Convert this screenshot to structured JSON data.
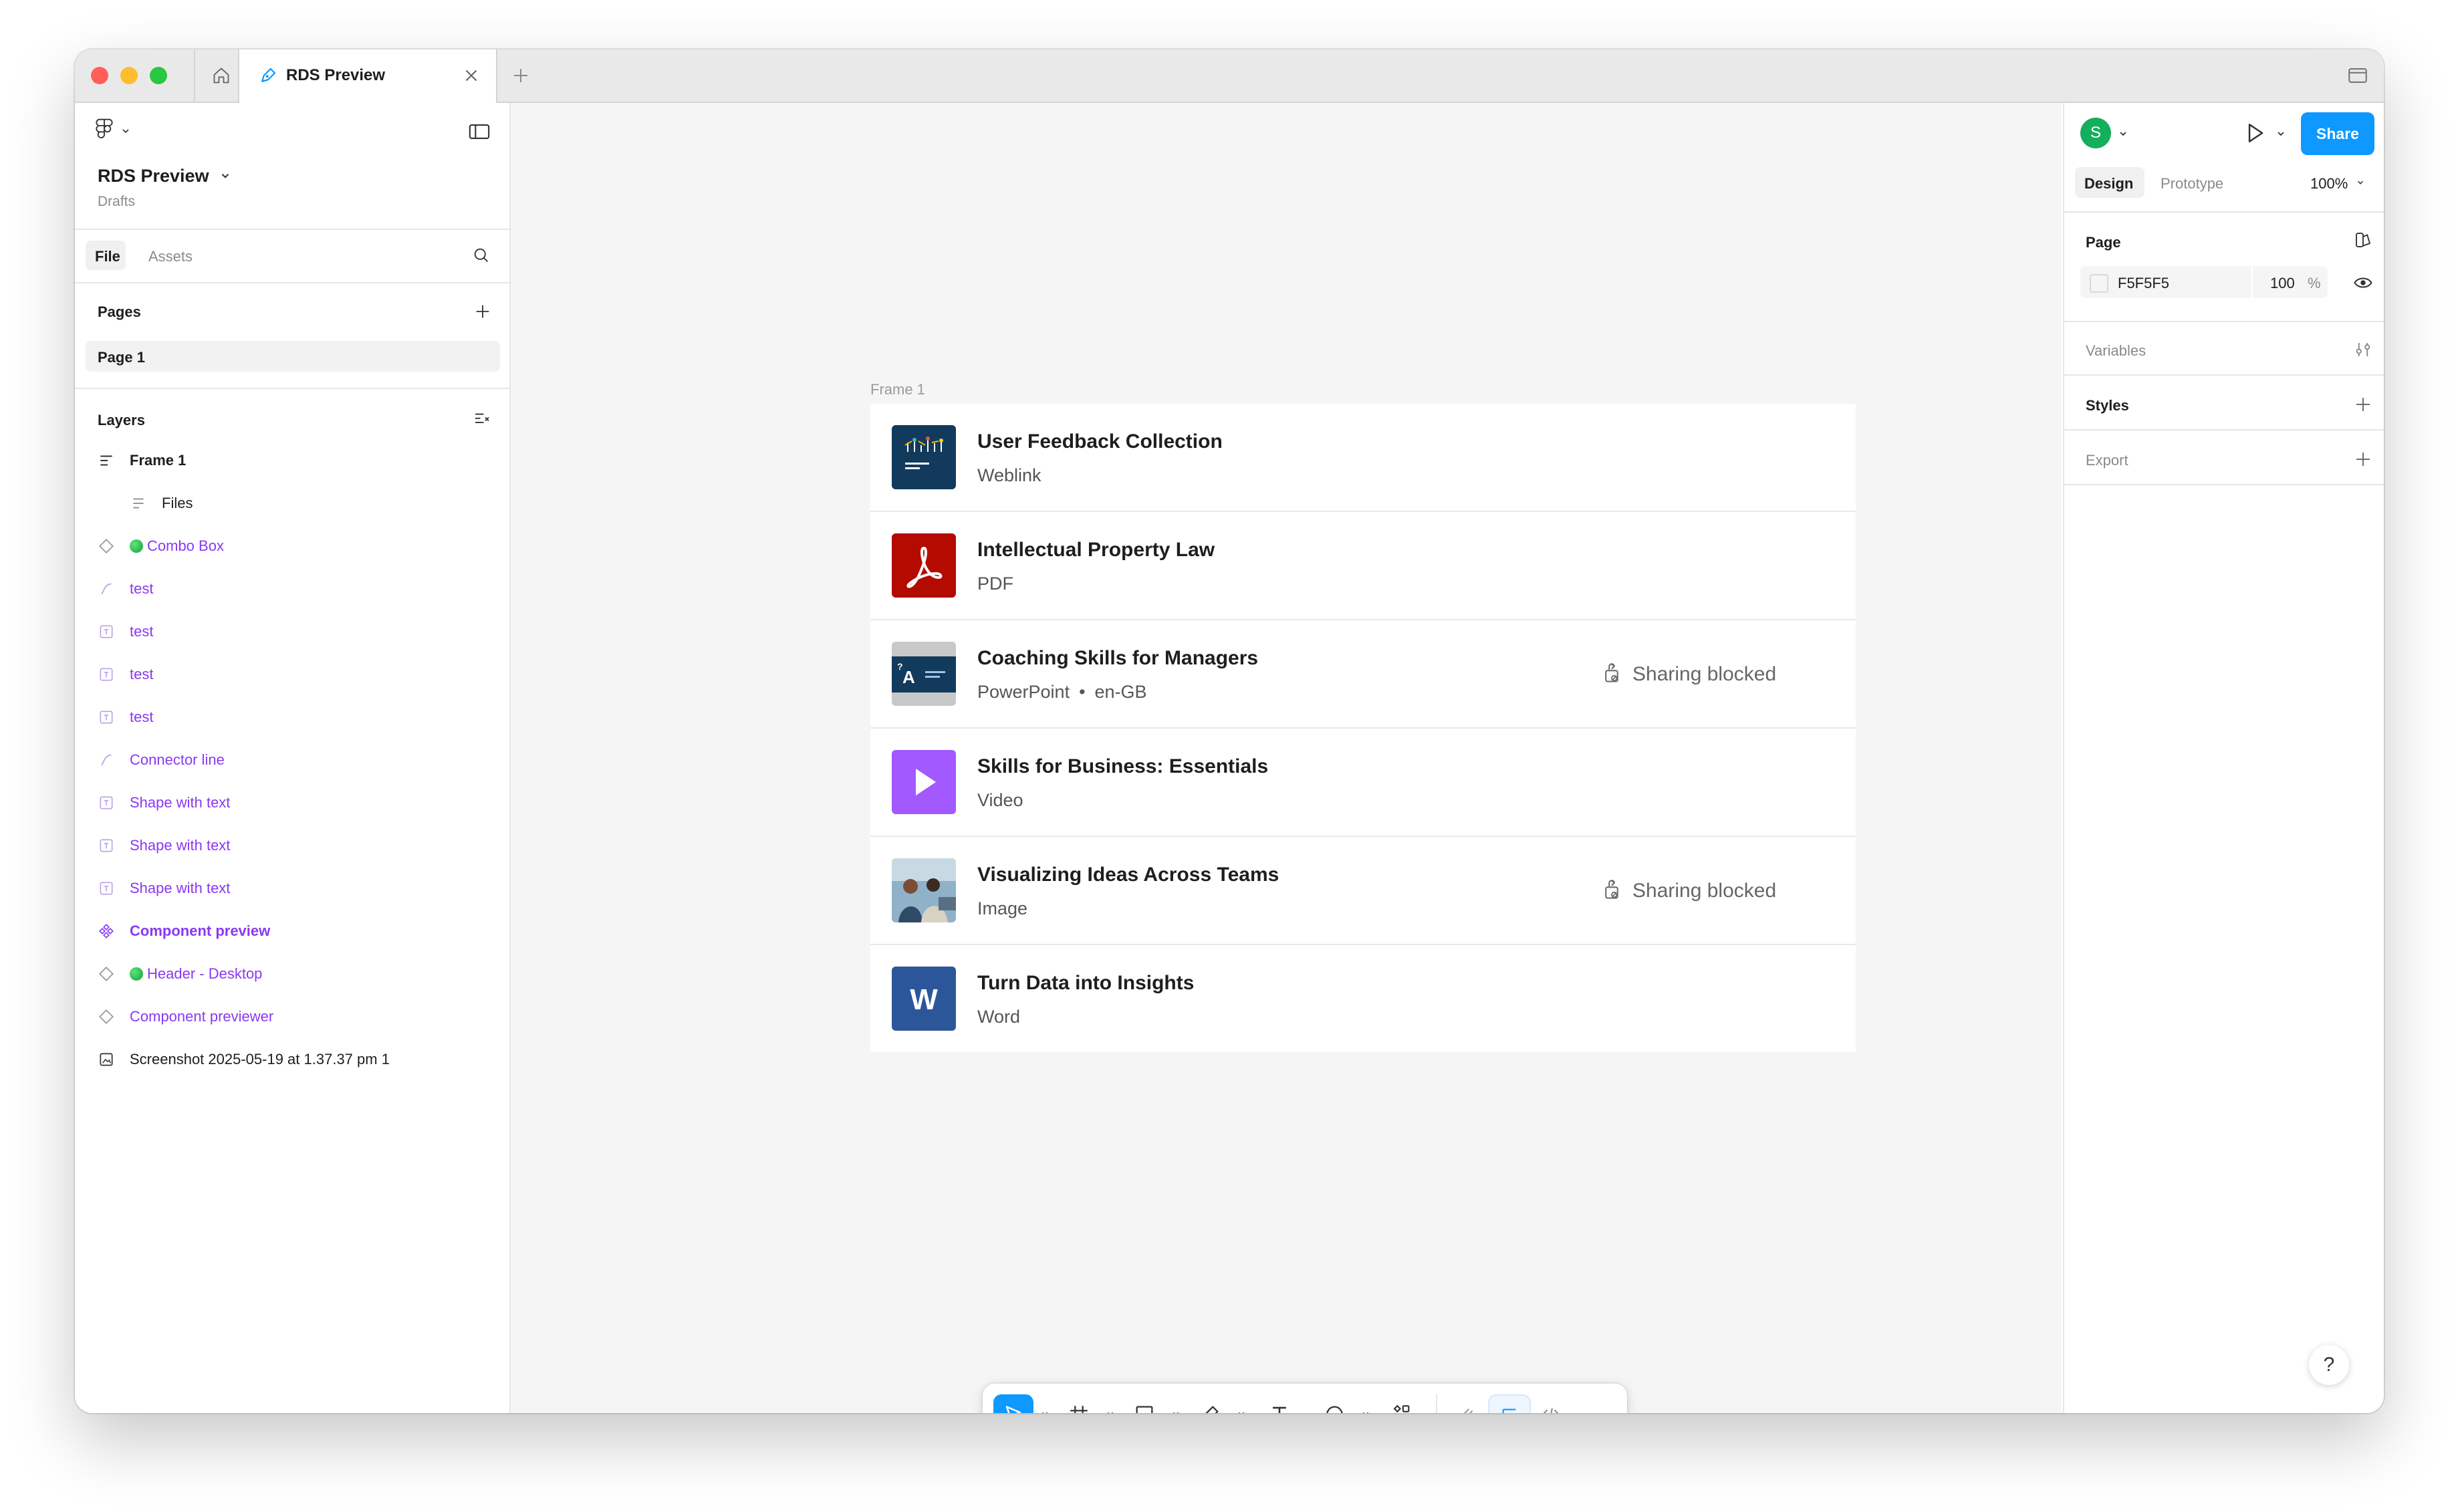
{
  "tab": {
    "title": "RDS Preview"
  },
  "file": {
    "name": "RDS Preview",
    "location": "Drafts"
  },
  "left_tabs": {
    "file": "File",
    "assets": "Assets"
  },
  "pages": {
    "heading": "Pages",
    "items": [
      "Page 1"
    ]
  },
  "layers": {
    "heading": "Layers",
    "items": [
      {
        "label": "Frame 1",
        "icon": "frame-icon"
      },
      {
        "label": "Files",
        "icon": "auto-layout-icon"
      },
      {
        "label": "Combo Box",
        "icon": "instance-icon"
      },
      {
        "label": "test",
        "icon": "connector-icon"
      },
      {
        "label": "test",
        "icon": "shape-text-icon"
      },
      {
        "label": "test",
        "icon": "shape-text-icon"
      },
      {
        "label": "test",
        "icon": "shape-text-icon"
      },
      {
        "label": "Connector line",
        "icon": "connector-icon"
      },
      {
        "label": "Shape with text",
        "icon": "shape-text-icon"
      },
      {
        "label": "Shape with text",
        "icon": "shape-text-icon"
      },
      {
        "label": "Shape with text",
        "icon": "shape-text-icon"
      },
      {
        "label": "Component preview",
        "icon": "component-icon"
      },
      {
        "label": "Header - Desktop",
        "icon": "instance-icon"
      },
      {
        "label": "Component previewer",
        "icon": "instance-icon"
      },
      {
        "label": "Screenshot 2025-05-19 at 1.37.37 pm 1",
        "icon": "image-icon"
      }
    ]
  },
  "canvas": {
    "frame_label": "Frame 1",
    "files": [
      {
        "title": "User Feedback Collection",
        "type": "Weblink",
        "locale": "",
        "blocked": "",
        "thumb": "weblink-thumbnail"
      },
      {
        "title": "Intellectual Property Law",
        "type": "PDF",
        "locale": "",
        "blocked": "",
        "thumb": "pdf-icon"
      },
      {
        "title": "Coaching Skills for Managers",
        "type": "PowerPoint",
        "locale": "en-GB",
        "blocked": "Sharing blocked",
        "thumb": "powerpoint-thumbnail"
      },
      {
        "title": "Skills for Business: Essentials",
        "type": "Video",
        "locale": "",
        "blocked": "",
        "thumb": "video-play-icon"
      },
      {
        "title": "Visualizing Ideas Across Teams",
        "type": "Image",
        "locale": "",
        "blocked": "Sharing blocked",
        "thumb": "image-thumbnail"
      },
      {
        "title": "Turn Data into Insights",
        "type": "Word",
        "locale": "",
        "blocked": "",
        "thumb": "word-icon"
      }
    ]
  },
  "right": {
    "avatar_initial": "S",
    "share": "Share",
    "tabs": {
      "design": "Design",
      "prototype": "Prototype"
    },
    "zoom": "100%",
    "page_heading": "Page",
    "page_color": "F5F5F5",
    "page_opacity": "100",
    "opacity_unit": "%",
    "variables": "Variables",
    "styles": "Styles",
    "export": "Export",
    "help": "?"
  },
  "colors": {
    "accent": "#0d99ff",
    "component_purple": "#8a38f5",
    "canvas_bg": "#F5F5F5",
    "pdf_red": "#b30b00",
    "video_purple": "#a259ff",
    "word_blue": "#2b579a"
  }
}
